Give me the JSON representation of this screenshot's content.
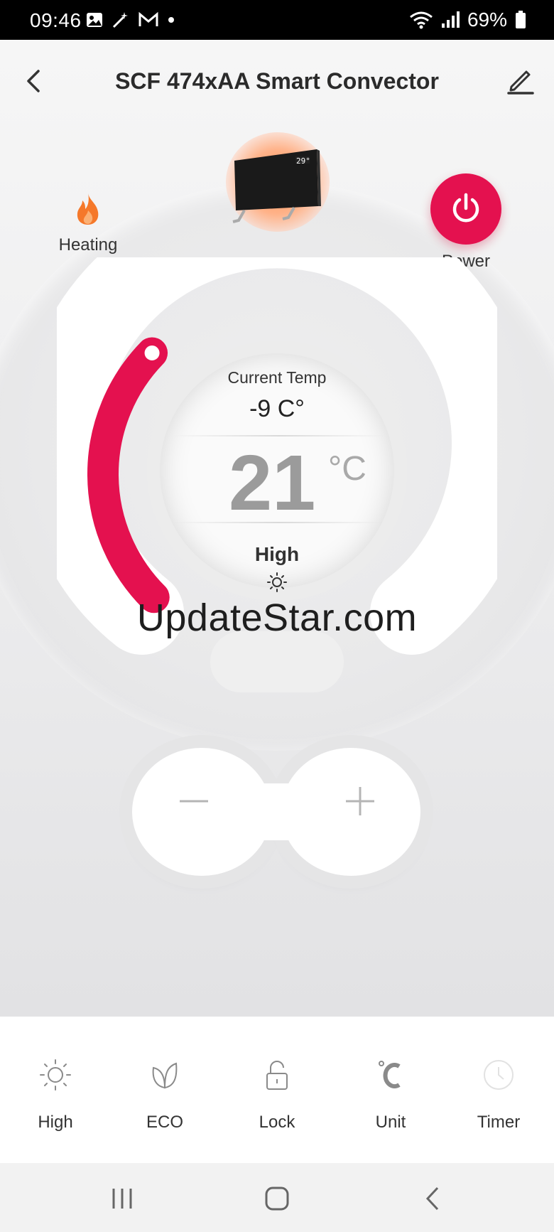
{
  "status": {
    "time": "09:46",
    "battery": "69%"
  },
  "header": {
    "title": "SCF 474xAA Smart Convector"
  },
  "heating": {
    "label": "Heating"
  },
  "power": {
    "label": "Power"
  },
  "dial": {
    "current_label": "Current Temp",
    "current_value": "-9 C°",
    "set_value": "21",
    "unit": "°C",
    "mode": "High",
    "level": 0.33
  },
  "watermark": "UpdateStar.com",
  "functions": [
    {
      "label": "High",
      "icon": "sun-icon"
    },
    {
      "label": "ECO",
      "icon": "leaf-icon"
    },
    {
      "label": "Lock",
      "icon": "lock-icon"
    },
    {
      "label": "Unit",
      "icon": "celsius-icon"
    },
    {
      "label": "Timer",
      "icon": "clock-icon"
    }
  ],
  "colors": {
    "accent": "#e4114f",
    "flame": "#f5782a"
  }
}
